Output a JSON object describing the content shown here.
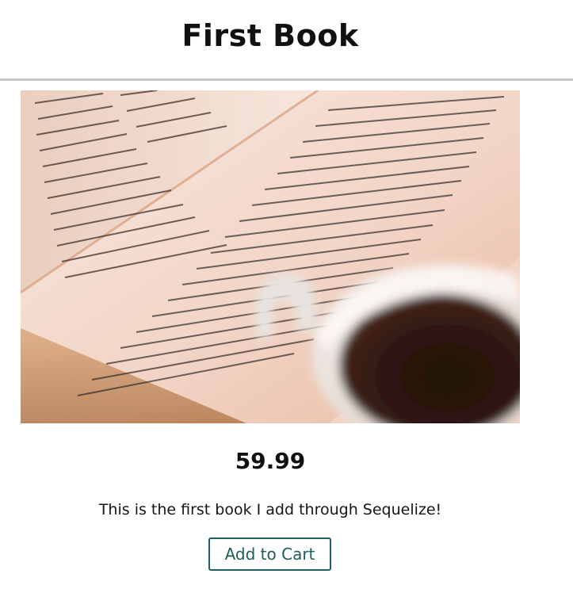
{
  "product": {
    "title": "First Book",
    "image_alt": "Open book and coffee cup",
    "price": "59.99",
    "description": "This is the first book I add through Sequelize!",
    "add_to_cart_label": "Add to Cart"
  },
  "colors": {
    "divider": "#c9c9c9",
    "button_border": "#1f5f5f",
    "button_text": "#1f5c5c"
  }
}
